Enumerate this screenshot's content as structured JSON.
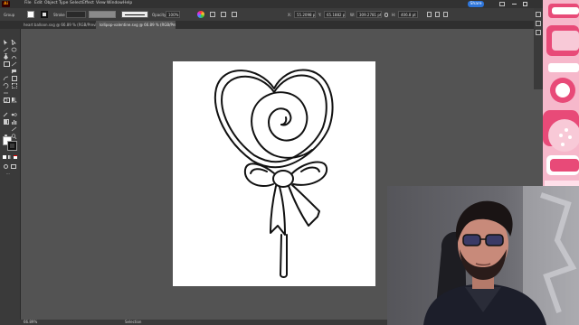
{
  "app": {
    "logo_text": "Ai",
    "menu": [
      "File",
      "Edit",
      "Object",
      "Type",
      "Select",
      "Effect",
      "View",
      "Window",
      "Help"
    ],
    "share_label": "Share"
  },
  "control_bar": {
    "selection_label": "Group",
    "stroke_label": "Stroke",
    "opacity_label": "Opacity",
    "opacity_value": "100%",
    "x_value": "55.2098 pt",
    "y_value": "65.1882 pt",
    "w_value": "309.2781 pt",
    "h_value": "406.8 pt"
  },
  "tabs": [
    {
      "label": "heart balloon.svg @ 66.89 % (RGB/Preview)",
      "active": false
    },
    {
      "label": "lollipop-valentine.svg @ 66.89 % (RGB/Preview)",
      "active": true
    }
  ],
  "status_bar": {
    "zoom": "66.89%",
    "tool_name": "Selection"
  },
  "colors": {
    "accent": "#2d74d8",
    "canvas_bg": "#535353",
    "artboard": "#ffffff",
    "thumbnail_pink": "#f6b8cb",
    "thumbnail_red": "#e84a78"
  },
  "icons": [
    "home-icon",
    "selection-tool-icon",
    "pen-tool-icon",
    "type-tool-icon",
    "fill-swatch-icon",
    "stroke-swatch-icon",
    "search-icon",
    "arrange-icon"
  ]
}
